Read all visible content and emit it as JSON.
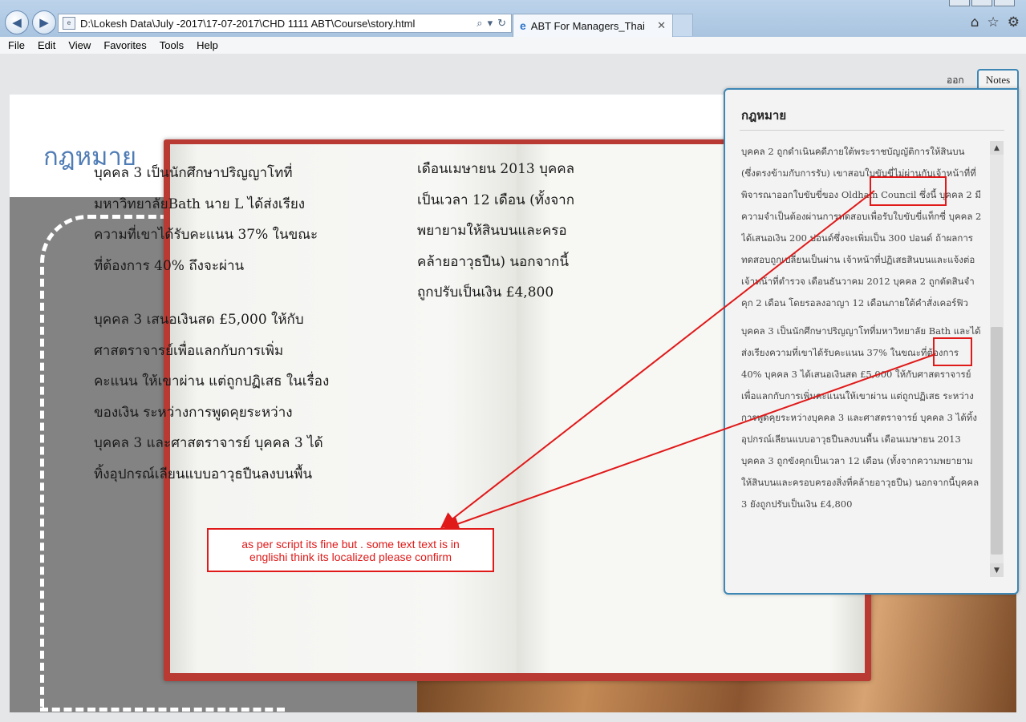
{
  "browser": {
    "url": "D:\\Lokesh Data\\July -2017\\17-07-2017\\CHD 1111 ABT\\Course\\story.html",
    "tab_title": "ABT For Managers_Thai",
    "menu": [
      "File",
      "Edit",
      "View",
      "Favorites",
      "Tools",
      "Help"
    ]
  },
  "slide": {
    "title": "กฎหมาย",
    "book_left_para1": [
      "บุคคล 3 เป็นนักศึกษาปริญญาโทที่",
      "มหาวิทยาลัยBath นาย L ได้ส่งเรียง",
      "ความที่เขาได้รับคะแนน 37%   ในขณะ",
      "ที่ต้องการ 40% ถึงจะผ่าน"
    ],
    "book_left_para2": [
      "บุคคล 3 เสนอเงินสด £5,000 ให้กับ",
      "ศาสตราจารย์เพื่อแลกกับการเพิ่ม",
      "คะแนน ให้เขาผ่าน แต่ถูกปฏิเสธ ในเรื่อง",
      "ของเงิน ระหว่างการพูดคุยระหว่าง",
      "บุคคล 3 และศาสตราจารย์  บุคคล 3  ได้",
      "ทิ้งอุปกรณ์เลียนแบบอาวุธปืนลงบนพื้น"
    ],
    "book_right": [
      "เดือนเมษายน 2013 บุคคล",
      "เป็นเวลา 12 เดือน (ทั้งจาก",
      "พยายามให้สินบนและครอ",
      "คล้ายอาวุธปืน)  นอกจากนี้",
      "ถูกปรับเป็นเงิน £4,800"
    ]
  },
  "notes": {
    "exit_label": "ออก",
    "tab_label": "Notes",
    "heading": "กฎหมาย",
    "para1": "บุคคล 2 ถูกดำเนินคดีภายใต้พระราชบัญญัติการให้สินบน (ซึ่งตรงข้ามกับการรับ) เขาสอบใบขับขี่ไม่ผ่านกับเจ้าหน้าที่ที่พิจารณาออกใบขับขี่ของ Oldham Council ซึ่งนี้ บุคคล 2 มีความจำเป็นต้องผ่านการทดสอบเพื่อรับใบขับขี่แท็กซี่ บุคคล 2 ได้เสนอเงิน 200 ปอนด์ซึ่งจะเพิ่มเป็น 300 ปอนด์ ถ้าผลการทดสอบถูกเปลี่ยนเป็นผ่าน เจ้าหน้าที่ปฏิเสธสินบนและแจ้งต่อเจ้าหน้าที่ตำรวจ เดือนธันวาคม 2012 บุคคล 2 ถูกตัดสินจำคุก 2 เดือน โดยรอลงอาญา 12 เดือนภายใต้คำสั่งเคอร์ฟิว",
    "para2": "บุคคล 3 เป็นนักศึกษาปริญญาโทที่มหาวิทยาลัย Bath และได้ส่งเรียงความที่เขาได้รับคะแนน 37%   ในขณะที่ต้องการ 40% บุคคล 3 ได้เสนอเงินสด £5,000 ให้กับศาสตราจารย์เพื่อแลกกับการเพิ่มคะแนนให้เขาผ่าน แต่ถูกปฏิเสธ ระหว่างการพูดคุยระหว่างบุคคล 3 และศาสตราจารย์  บุคคล 3 ได้ทิ้งอุปกรณ์เลียนแบบอาวุธปืนลงบนพื้น  เดือนเมษายน 2013 บุคคล 3 ถูกขังคุกเป็นเวลา 12 เดือน (ทั้งจากความพยายามให้สินบนและครอบครองสิ่งที่คล้ายอาวุธปืน)  นอกจากนี้บุคคล 3 ยังถูกปรับเป็นเงิน £4,800"
  },
  "annotation": {
    "callout_line1": "as per script its fine but . some text text is in",
    "callout_line2": "englishi think its localized please confirm",
    "highlight1": "Oldham Council",
    "highlight2": "Bath",
    "color": "#e01919"
  }
}
